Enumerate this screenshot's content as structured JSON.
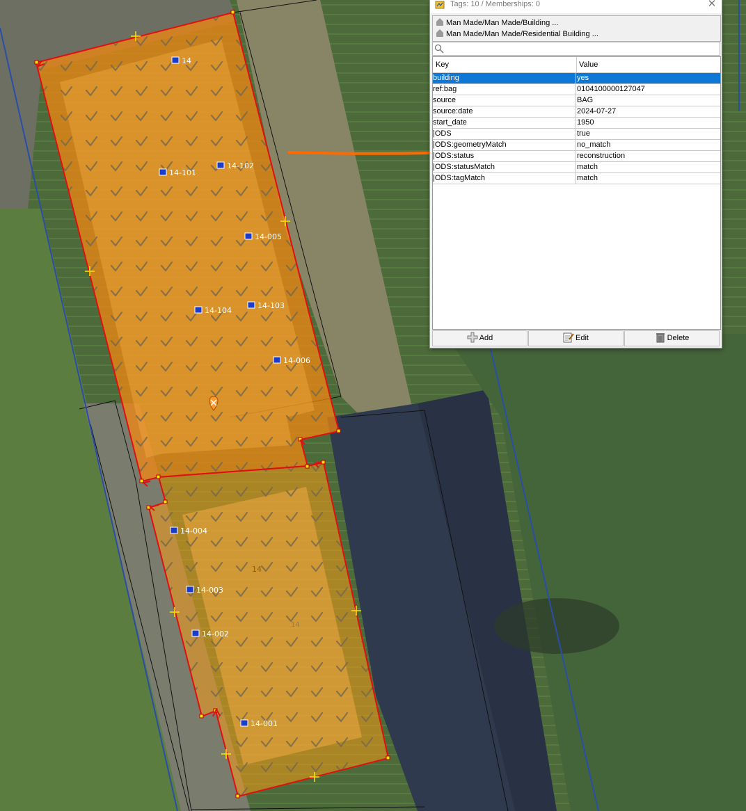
{
  "dialog": {
    "title": "Tags: 10 / Memberships: 0",
    "presets": [
      "Man Made/Man Made/Building ...",
      "Man Made/Man Made/Residential Building ..."
    ],
    "search": {
      "value": "",
      "placeholder": ""
    },
    "columns": {
      "key": "Key",
      "value": "Value"
    },
    "tags": [
      {
        "key": "building",
        "value": "yes"
      },
      {
        "key": "ref:bag",
        "value": "0104100000127047"
      },
      {
        "key": "source",
        "value": "BAG"
      },
      {
        "key": "source:date",
        "value": "2024-07-27"
      },
      {
        "key": "start_date",
        "value": "1950"
      },
      {
        "key": "|ODS",
        "value": "true"
      },
      {
        "key": "|ODS:geometryMatch",
        "value": "no_match"
      },
      {
        "key": "|ODS:status",
        "value": "reconstruction"
      },
      {
        "key": "|ODS:statusMatch",
        "value": "match"
      },
      {
        "key": "|ODS:tagMatch",
        "value": "match"
      }
    ],
    "buttons": {
      "add": "Add",
      "edit": "Edit",
      "delete": "Delete"
    },
    "selected_row": 0
  },
  "map": {
    "address_labels": [
      "14",
      "14-101",
      "14-102",
      "14-005",
      "14-104",
      "14-103",
      "14-006",
      "14-004",
      "14-003",
      "14-002",
      "14-001"
    ],
    "building_labels": [
      "14",
      "14"
    ],
    "colors": {
      "building_fill": "#f59a16",
      "building_outline": "#e01010",
      "highlight": "#ff6a00",
      "address_icon": "#1a3cc8"
    }
  }
}
